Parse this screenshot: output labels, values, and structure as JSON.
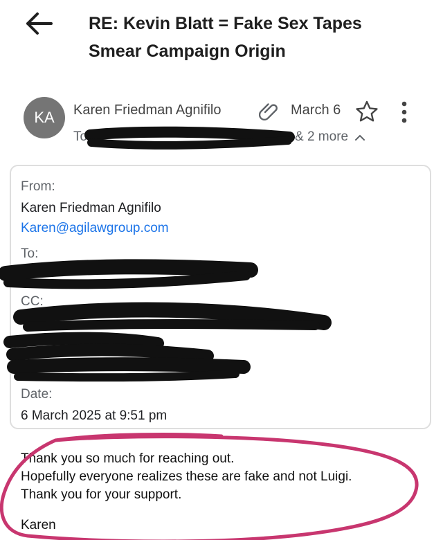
{
  "header": {
    "subject": "RE: Kevin Blatt = Fake Sex Tapes Smear Campaign Origin"
  },
  "sender": {
    "avatar_initials": "KA",
    "name": "Karen Friedman Agnifilo",
    "to_prefix": "To",
    "date": "March 6",
    "more_recipients": "& 2 more"
  },
  "details": {
    "from_label": "From:",
    "from_name": "Karen Friedman Agnifilo",
    "from_email": "Karen@agilawgroup.com",
    "to_label": "To:",
    "cc_label": "CC:",
    "date_label": "Date:",
    "date_value": "6 March 2025 at 9:51 pm"
  },
  "message": {
    "lines": [
      "Thank you so much for reaching out.",
      "Hopefully everyone realizes these are fake and not Luigi.",
      "Thank you for your support."
    ],
    "signature": "Karen"
  },
  "colors": {
    "avatar_bg": "#757575",
    "link": "#1a73e8",
    "card_border": "#dedede",
    "circle_highlight": "#c8366f",
    "redaction": "#111111"
  }
}
